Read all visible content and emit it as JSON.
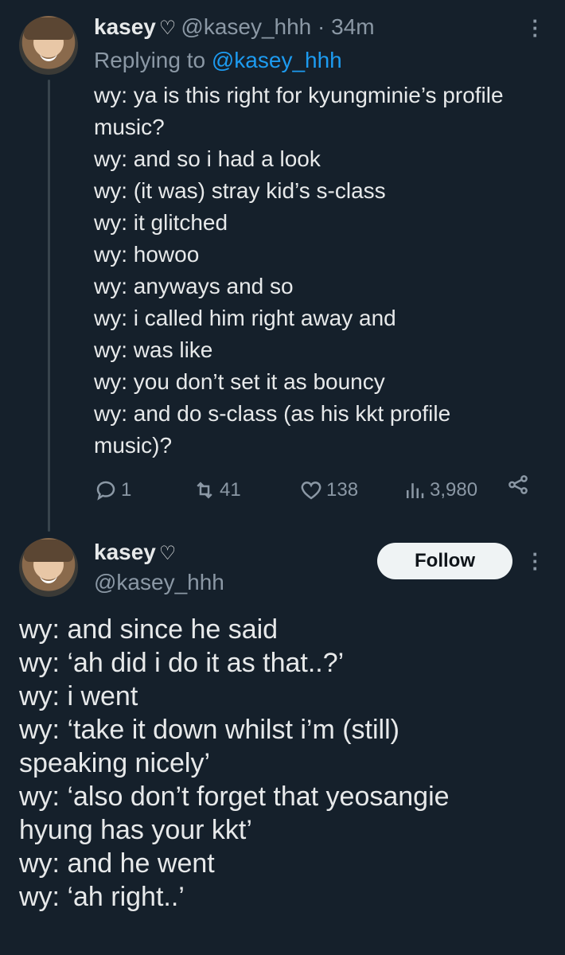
{
  "tweet1": {
    "name": "kasey",
    "heart": "♡",
    "handle": "@kasey_hhh",
    "dot": "·",
    "time": "34m",
    "replying_prefix": "Replying to",
    "replying_mention": "@kasey_hhh",
    "lines": [
      "wy: ya is this right for kyungminie’s profile",
      "music?",
      "wy: and so i had a look",
      "wy: (it was) stray kid’s s-class",
      "wy: it glitched",
      "wy: howoo",
      "wy: anyways and so",
      "wy: i called him right away and",
      "wy: was like",
      "wy: you don’t set it as bouncy",
      "wy: and do s-class (as his kkt profile",
      "music)?"
    ],
    "stats": {
      "replies": "1",
      "retweets": "41",
      "likes": "138",
      "views": "3,980"
    }
  },
  "tweet2": {
    "name": "kasey",
    "heart": "♡",
    "handle": "@kasey_hhh",
    "follow_label": "Follow",
    "lines": [
      "wy: and since he said",
      "wy: ‘ah did i do it as that..?’",
      "wy: i went",
      "wy: ‘take it down whilst i’m (still)",
      "speaking nicely’",
      "wy: ‘also don’t forget that yeosangie",
      "hyung has your kkt’",
      "wy: and he went",
      "wy: ‘ah right..’"
    ]
  },
  "icons": {
    "more": "more-icon",
    "reply": "reply-icon",
    "retweet": "retweet-icon",
    "like": "heart-icon",
    "views": "views-icon",
    "share": "share-icon"
  },
  "colors": {
    "background": "#15202b",
    "text": "#e7e9ea",
    "muted": "#8b98a5",
    "accent": "#1d9bf0",
    "thread_line": "#38444d",
    "follow_bg": "#eff3f4"
  }
}
